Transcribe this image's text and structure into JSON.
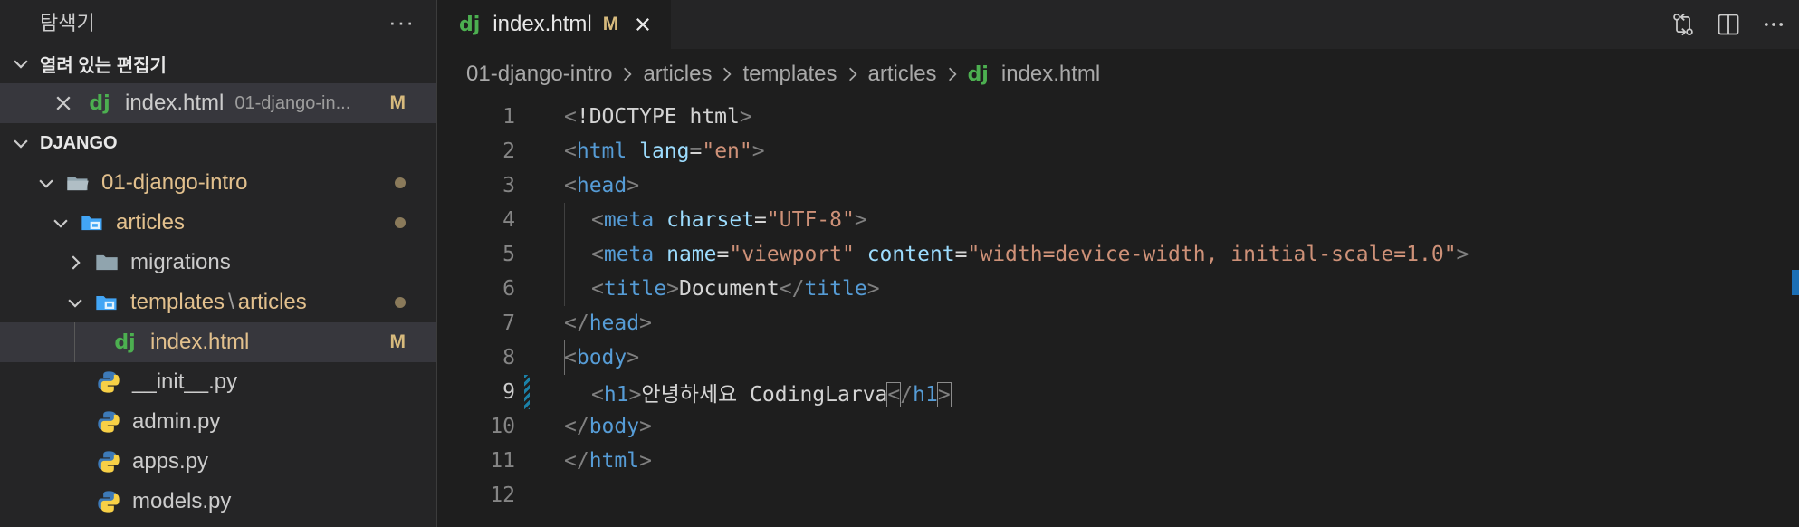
{
  "sidebar": {
    "title": "탐색기",
    "more_label": "···",
    "open_editors": {
      "header": "열려 있는 편집기",
      "items": [
        {
          "name": "index.html",
          "description": "01-django-in...",
          "badge": "M"
        }
      ]
    },
    "workspace": {
      "header": "DJANGO",
      "tree": [
        {
          "label": "01-django-intro"
        },
        {
          "label": "articles"
        },
        {
          "label": "migrations"
        },
        {
          "label_a": "templates",
          "label_sep": "\\",
          "label_b": "articles"
        },
        {
          "label": "index.html",
          "badge": "M"
        },
        {
          "label": "__init__.py"
        },
        {
          "label": "admin.py"
        },
        {
          "label": "apps.py"
        },
        {
          "label": "models.py"
        }
      ]
    }
  },
  "editor": {
    "tab": {
      "label": "index.html",
      "badge": "M"
    },
    "breadcrumb": [
      "01-django-intro",
      "articles",
      "templates",
      "articles",
      "index.html"
    ],
    "line_numbers": [
      "1",
      "2",
      "3",
      "4",
      "5",
      "6",
      "7",
      "8",
      "9",
      "10",
      "11",
      "12"
    ],
    "current_line": 9,
    "code": {
      "l1": {
        "a": "<",
        "b": "!DOCTYPE html",
        "c": ">"
      },
      "l2": {
        "tag": "html",
        "attr": "lang",
        "val": "\"en\""
      },
      "l3": {
        "tag": "head"
      },
      "l4": {
        "tag": "meta",
        "attr": "charset",
        "val": "\"UTF-8\""
      },
      "l5": {
        "tag": "meta",
        "attr1": "name",
        "val1": "\"viewport\"",
        "attr2": "content",
        "val2": "\"width=device-width, initial-scale=1.0\""
      },
      "l6": {
        "tag": "title",
        "text": "Document"
      },
      "l7": {
        "tag": "head"
      },
      "l8": {
        "tag": "body"
      },
      "l9": {
        "tag": "h1",
        "text": "안녕하세요 CodingLarva"
      },
      "l10": {
        "tag": "body"
      },
      "l11": {
        "tag": "html"
      }
    }
  },
  "icons": {
    "compare": "compare-changes-icon",
    "split": "split-editor-icon",
    "more": "more-actions-icon"
  },
  "colors": {
    "accent": "#4caf50",
    "modified": "#d7ba7d",
    "tag": "#569cd6",
    "attr": "#9cdcfe",
    "string": "#ce9178"
  }
}
